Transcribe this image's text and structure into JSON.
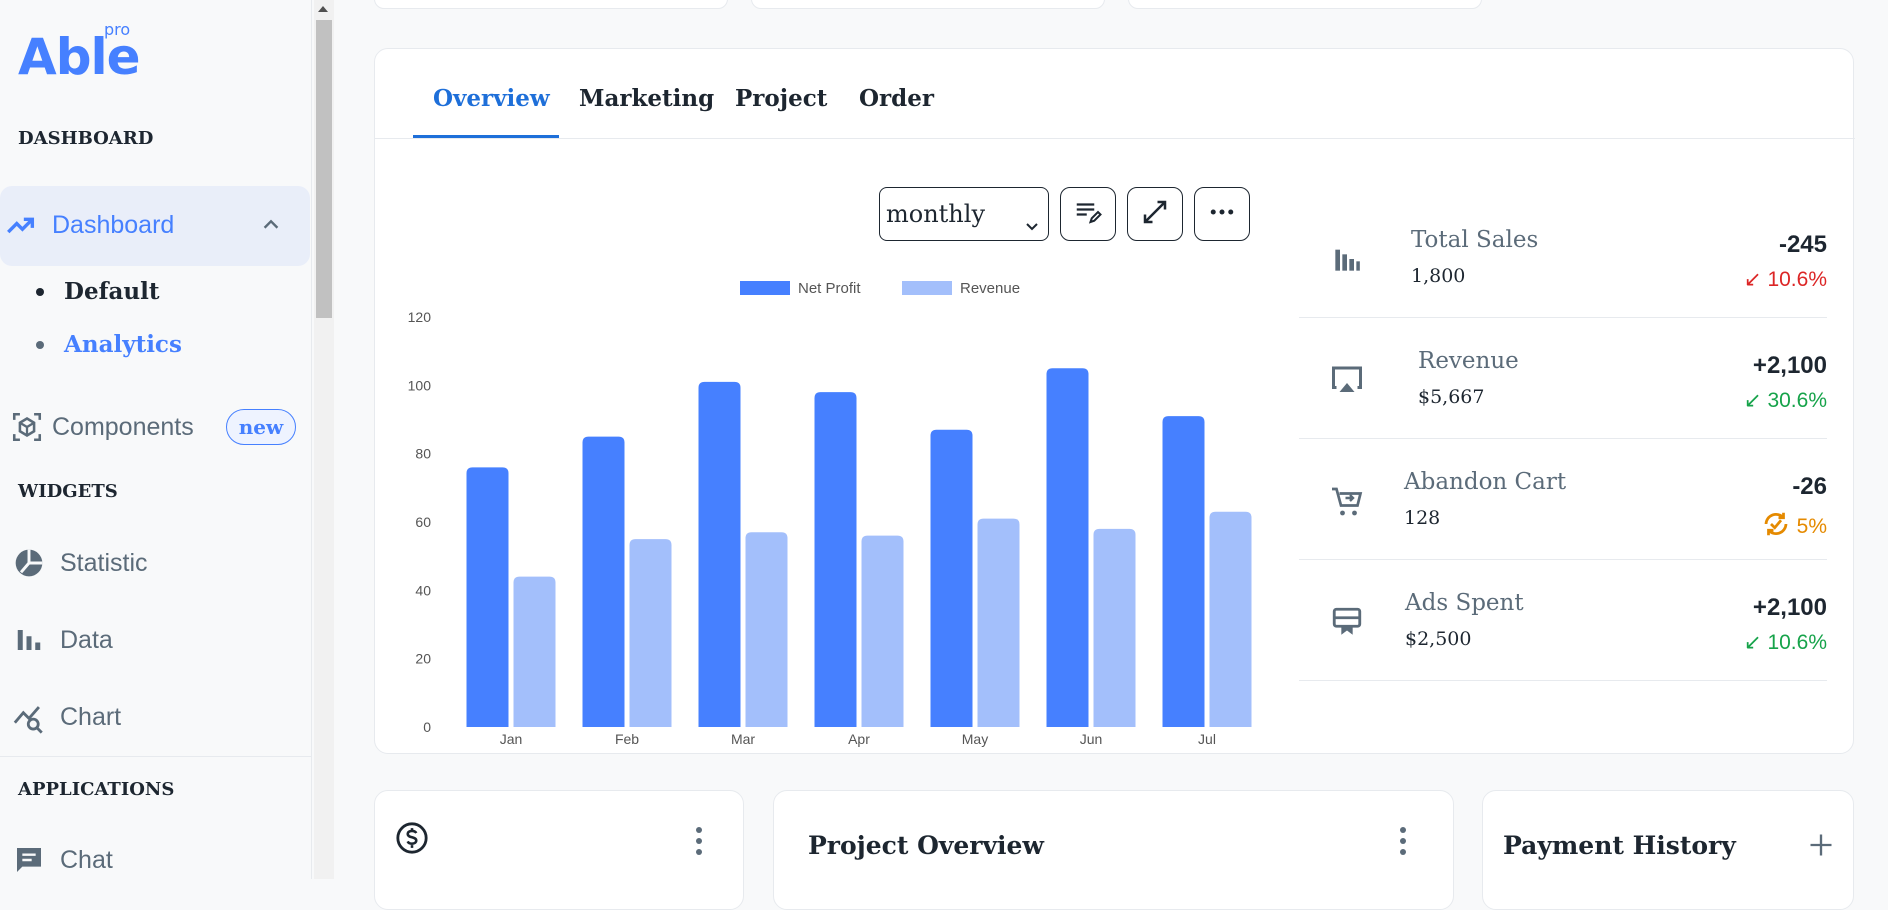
{
  "brand": {
    "name": "Able",
    "tier": "pro"
  },
  "sidebar": {
    "sections": [
      "DASHBOARD",
      "WIDGETS",
      "APPLICATIONS"
    ],
    "dashboard": {
      "label": "Dashboard",
      "sub": [
        "Default",
        "Analytics"
      ]
    },
    "components": {
      "label": "Components",
      "badge": "new"
    },
    "widgets": [
      "Statistic",
      "Data",
      "Chart"
    ],
    "apps": [
      "Chat"
    ]
  },
  "tabs": [
    "Overview",
    "Marketing",
    "Project",
    "Order"
  ],
  "filter": {
    "selected": "monthly"
  },
  "stats": [
    {
      "title": "Total Sales",
      "value": "1,800",
      "change": "-245",
      "pct": "10.6%",
      "trend": "red",
      "icon": "bar-chart-icon"
    },
    {
      "title": "Revenue",
      "value": "$5,667",
      "change": "+2,100",
      "pct": "30.6%",
      "trend": "green",
      "icon": "airplay-icon"
    },
    {
      "title": "Abandon Cart",
      "value": "128",
      "change": "-26",
      "pct": "5%",
      "trend": "orange",
      "icon": "cart-icon"
    },
    {
      "title": "Ads Spent",
      "value": "$2,500",
      "change": "+2,100",
      "pct": "10.6%",
      "trend": "green",
      "icon": "billboard-icon"
    }
  ],
  "bottom_cards": [
    "",
    "Project Overview",
    "Payment History"
  ],
  "colors": {
    "accent": "#4680ff",
    "accent_light": "#a3bffb",
    "tab_active": "#1e6fd9"
  },
  "chart_data": {
    "type": "bar",
    "categories": [
      "Jan",
      "Feb",
      "Mar",
      "Apr",
      "May",
      "Jun",
      "Jul"
    ],
    "series": [
      {
        "name": "Net Profit",
        "values": [
          76,
          85,
          101,
          98,
          87,
          105,
          91
        ],
        "color": "#4680ff"
      },
      {
        "name": "Revenue",
        "values": [
          44,
          55,
          57,
          56,
          61,
          58,
          63
        ],
        "color": "#a3bffb"
      }
    ],
    "yticks": [
      0,
      20,
      40,
      60,
      80,
      100,
      120
    ],
    "ylim": [
      0,
      120
    ],
    "legend": "top-center"
  }
}
